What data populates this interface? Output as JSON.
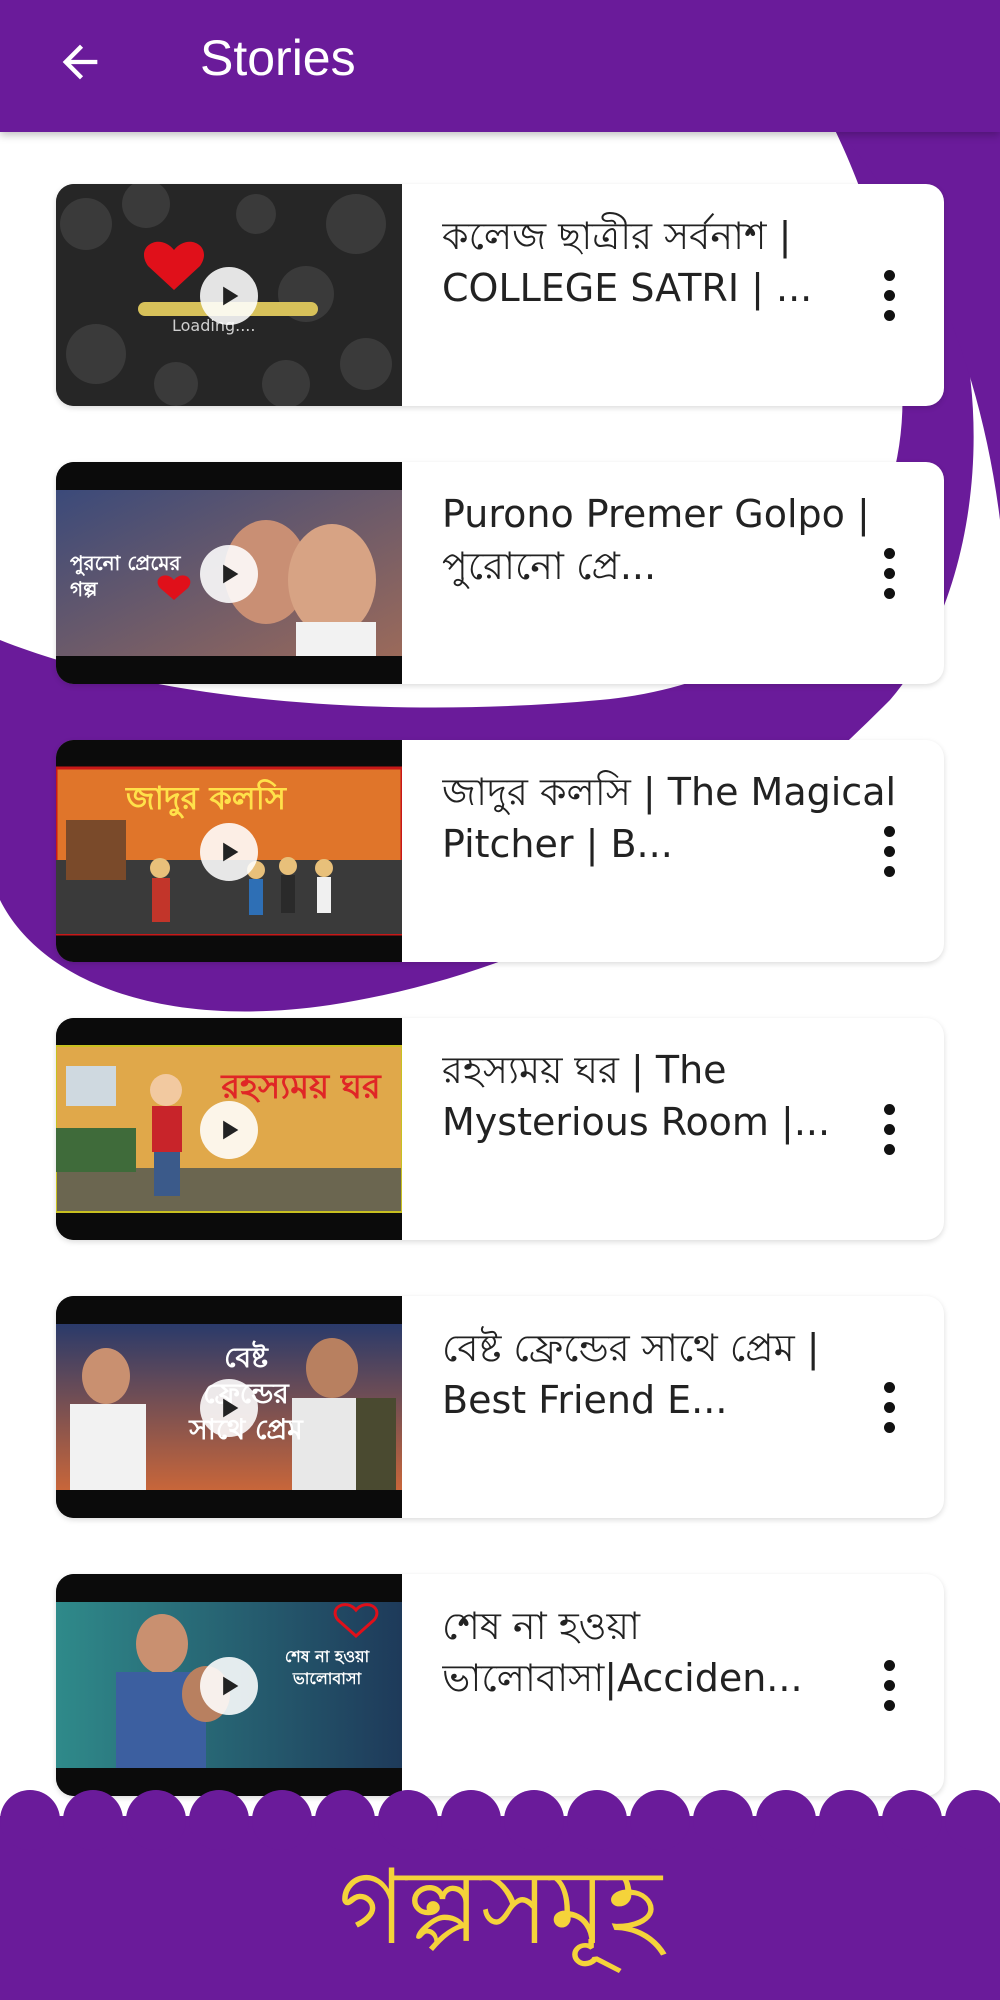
{
  "header": {
    "title": "Stories",
    "back_icon": "arrow-back-icon"
  },
  "colors": {
    "primary": "#6a1b9a",
    "footer_text": "#f5d33a",
    "card_bg": "#ffffff"
  },
  "stories": [
    {
      "title": "কলেজ ছাত্রীর সর্বনাশ | COLLEGE SATRI | ...",
      "thumb_caption": "Loading...."
    },
    {
      "title": "Purono Premer Golpo | পুরোনো প্রে...",
      "thumb_caption": "পুরনো প্রেমের গল্প"
    },
    {
      "title": "জাদুর কলসি | The Magical Pitcher | B...",
      "thumb_caption": "জাদুর কলসি"
    },
    {
      "title": "রহস্যময় ঘর | The Mysterious Room |...",
      "thumb_caption": "রহস্যময় ঘর"
    },
    {
      "title": "বেষ্ট ফ্রেন্ডের সাথে প্রেম | Best Friend E...",
      "thumb_caption": "বেষ্ট ফ্রেন্ডের সাথে প্রেম"
    },
    {
      "title": "শেষ না হওয়া ভালোবাসা|Acciden...",
      "thumb_caption": "শেষ না হওয়া ভালোবাসা"
    }
  ],
  "footer": {
    "title": "গল্পসমূহ"
  }
}
